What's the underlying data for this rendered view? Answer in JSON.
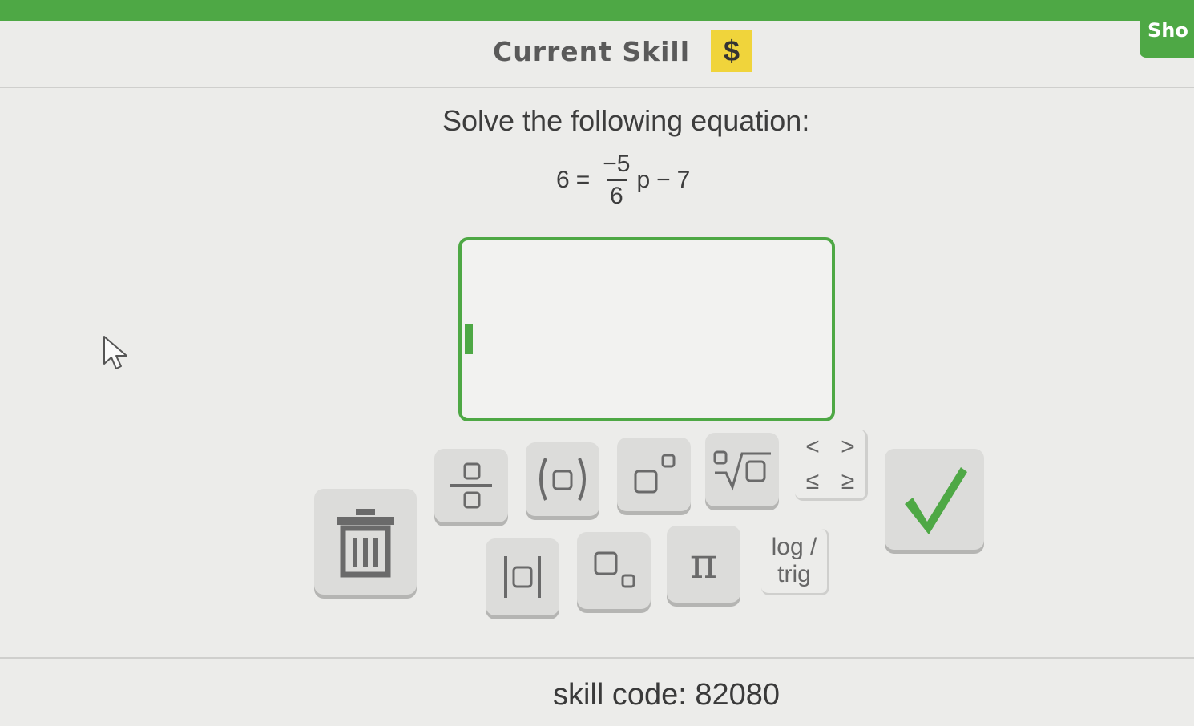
{
  "header": {
    "title": "Current Skill",
    "badge_symbol": "$",
    "show_button_label": "Sho"
  },
  "problem": {
    "instruction": "Solve the following equation:",
    "equation": {
      "lhs": "6",
      "equals": "=",
      "numerator": "−5",
      "denominator": "6",
      "variable": "p",
      "minus": "−",
      "constant": "7"
    }
  },
  "answer": {
    "value": ""
  },
  "keypad": {
    "pi_label": "π",
    "inequalities": [
      "<",
      ">",
      "≤",
      "≥"
    ],
    "log_label": "log /",
    "trig_label": "trig"
  },
  "footer": {
    "skill_code": "skill code: 82080"
  },
  "colors": {
    "accent_green": "#4ea845",
    "badge_yellow": "#f0d43b",
    "background": "#ececea",
    "key_gray": "#dcdcda"
  },
  "icons": {
    "trash": "trash-icon",
    "fraction": "fraction-icon",
    "parentheses": "parentheses-icon",
    "exponent": "exponent-icon",
    "nth_root": "nth-root-icon",
    "absolute_value": "absolute-value-icon",
    "subscript": "subscript-icon",
    "check": "check-icon",
    "cursor": "mouse-pointer-icon"
  }
}
